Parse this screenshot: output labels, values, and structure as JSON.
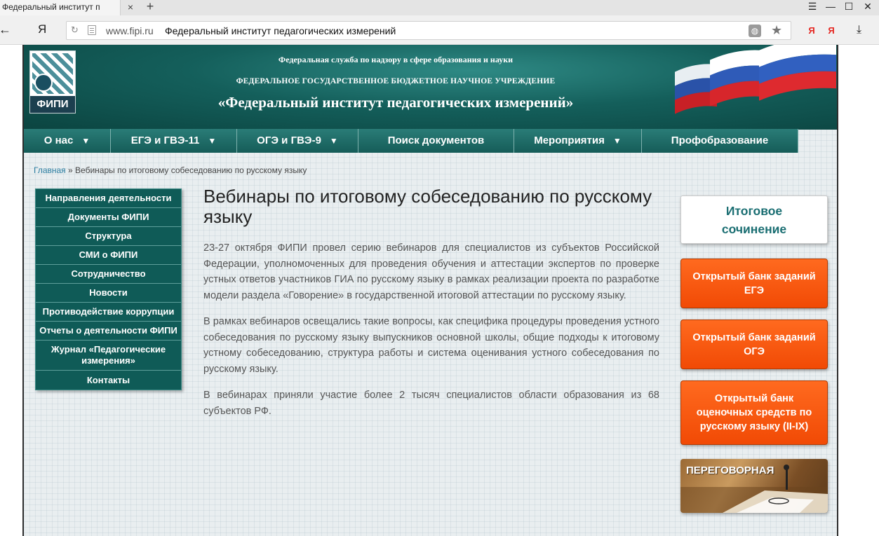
{
  "browser": {
    "tab_title": "Федеральный институт п",
    "tab_close": "×",
    "new_tab": "+",
    "win_menu": "☰",
    "win_min": "—",
    "win_max": "☐",
    "win_close": "✕",
    "back": "←",
    "yandex_button": "Я",
    "refresh": "↻",
    "url_domain": "www.fipi.ru",
    "url_title": "Федеральный институт педагогических измерений",
    "bookmark_star": "★",
    "ext1": "Я",
    "ext2": "Я",
    "download": "⤓"
  },
  "header": {
    "logo_text": "ФИПИ",
    "line1": "Федеральная служба по надзору в сфере образования и науки",
    "line2": "ФЕДЕРАЛЬНОЕ ГОСУДАРСТВЕННОЕ БЮДЖЕТНОЕ НАУЧНОЕ УЧРЕЖДЕНИЕ",
    "line3": "«Федеральный институт педагогических измерений»"
  },
  "nav": {
    "items": [
      {
        "label": "О нас",
        "arrow": "▼"
      },
      {
        "label": "ЕГЭ и ГВЭ-11",
        "arrow": "▼"
      },
      {
        "label": "ОГЭ и ГВЭ-9",
        "arrow": "▼"
      },
      {
        "label": "Поиск документов",
        "arrow": ""
      },
      {
        "label": "Мероприятия",
        "arrow": "▼"
      },
      {
        "label": "Профобразование",
        "arrow": ""
      }
    ]
  },
  "breadcrumb": {
    "home": "Главная",
    "separator": " » ",
    "current": "Вебинары по итоговому собеседованию по русскому языку"
  },
  "left_menu": {
    "items": [
      "Направления деятельности",
      "Документы ФИПИ",
      "Структура",
      "СМИ о ФИПИ",
      "Сотрудничество",
      "Новости",
      "Противодействие коррупции",
      "Отчеты о деятельности ФИПИ",
      "Журнал «Педагогические измерения»",
      "Контакты"
    ]
  },
  "article": {
    "title": "Вебинары по итоговому собеседованию по русскому языку",
    "paragraphs": [
      "23-27 октября ФИПИ провел серию вебинаров для специалистов из субъектов Российской Федерации, уполномоченных для проведения обучения и аттестации экспертов по проверке устных ответов участников ГИА по русскому языку в рамках реализации проекта по разработке модели раздела «Говорение» в государственной итоговой аттестации по русскому языку.",
      "В рамках вебинаров освещались такие вопросы, как специфика процедуры проведения устного собеседования по русскому языку выпускников основной школы, общие подходы к итоговому устному собеседованию, структура работы и система оценивания устного собеседования по русскому языку.",
      "В вебинарах приняли участие более 2 тысяч специалистов области образования из 68 субъектов РФ."
    ]
  },
  "sidebar": {
    "essay": "Итоговое сочинение",
    "bank_ege": "Открытый банк заданий ЕГЭ",
    "bank_oge": "Открытый банк заданий ОГЭ",
    "bank_russian": "Открытый банк оценочных средств по русскому языку (II-IX)",
    "negotiation": "ПЕРЕГОВОРНАЯ"
  },
  "colors": {
    "header_teal": "#145f5b",
    "nav_teal": "#1f6e6a",
    "orange": "#f45a10",
    "link": "#2c7ea1"
  }
}
